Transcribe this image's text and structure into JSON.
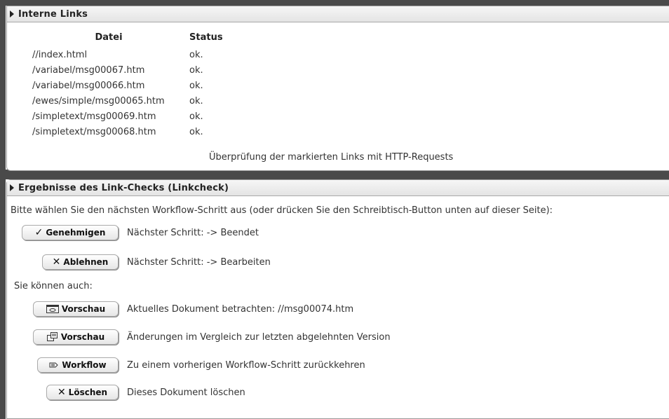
{
  "section1": {
    "title": "Interne Links",
    "col_file": "Datei",
    "col_status": "Status",
    "rows": [
      {
        "file": "//index.html",
        "status": "ok."
      },
      {
        "file": "/variabel/msg00067.htm",
        "status": "ok."
      },
      {
        "file": "/variabel/msg00066.htm",
        "status": "ok."
      },
      {
        "file": "/ewes/simple/msg00065.htm",
        "status": "ok."
      },
      {
        "file": "/simpletext/msg00069.htm",
        "status": "ok."
      },
      {
        "file": "/simpletext/msg00068.htm",
        "status": "ok."
      }
    ],
    "check_note": "Überprüfung der markierten Links mit HTTP-Requests"
  },
  "section2": {
    "title": "Ergebnisse des Link-Checks (Linkcheck)",
    "instruction": "Bitte wählen Sie den nächsten Workflow-Schritt aus (oder drücken Sie den Schreibtisch-Button unten auf dieser Seite):",
    "also_label": "Sie können auch:",
    "actions": [
      {
        "label": "Genehmigen",
        "icon": "check-icon",
        "desc": "Nächster Schritt: -> Beendet"
      },
      {
        "label": "Ablehnen",
        "icon": "x-icon",
        "desc": "Nächster Schritt: -> Bearbeiten"
      },
      {
        "label": "Vorschau",
        "icon": "preview-eye-icon",
        "desc": "Aktuelles Dokument betrachten: //msg00074.htm"
      },
      {
        "label": "Vorschau",
        "icon": "compare-icon",
        "desc": "Änderungen im Vergleich zur letzten abgelehnten Version"
      },
      {
        "label": "Workflow",
        "icon": "workflow-icon",
        "desc": "Zu einem vorherigen Workflow-Schritt zurückkehren"
      },
      {
        "label": "Löschen",
        "icon": "x-icon",
        "desc": "Dieses Dokument löschen"
      }
    ]
  }
}
